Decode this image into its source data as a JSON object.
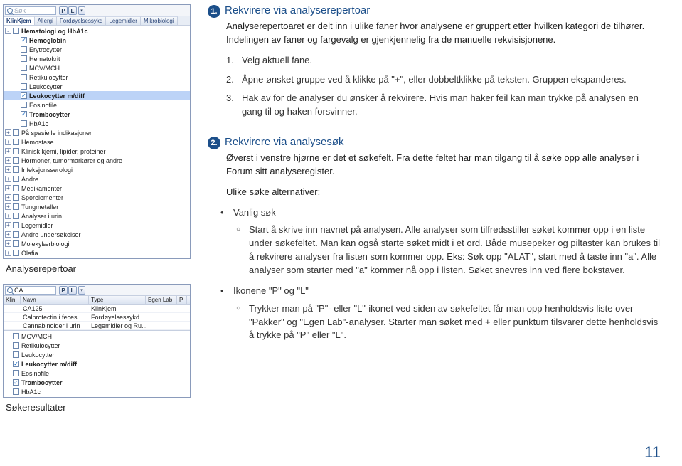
{
  "left_panel_repertoire": {
    "search_placeholder": "Søk",
    "pl_p": "P",
    "pl_l": "L",
    "tabs": [
      "KlinKjem",
      "Allergi",
      "Fordøyelsessykd",
      "Legemidler",
      "Mikrobiologi"
    ],
    "tree": [
      {
        "depth": 0,
        "exp": "-",
        "chk": false,
        "label": "Hematologi og HbA1c",
        "group": true
      },
      {
        "depth": 1,
        "exp": null,
        "chk": true,
        "label": "Hemoglobin",
        "sel": false,
        "bold": true
      },
      {
        "depth": 1,
        "exp": null,
        "chk": false,
        "label": "Erytrocytter"
      },
      {
        "depth": 1,
        "exp": null,
        "chk": false,
        "label": "Hematokrit"
      },
      {
        "depth": 1,
        "exp": null,
        "chk": false,
        "label": "MCV/MCH"
      },
      {
        "depth": 1,
        "exp": null,
        "chk": false,
        "label": "Retikulocytter"
      },
      {
        "depth": 1,
        "exp": null,
        "chk": false,
        "label": "Leukocytter"
      },
      {
        "depth": 1,
        "exp": null,
        "chk": true,
        "label": "Leukocytter m/diff",
        "sel": true,
        "bold": true
      },
      {
        "depth": 1,
        "exp": null,
        "chk": false,
        "label": "Eosinofile"
      },
      {
        "depth": 1,
        "exp": null,
        "chk": true,
        "label": "Trombocytter",
        "bold": true
      },
      {
        "depth": 1,
        "exp": null,
        "chk": false,
        "label": "HbA1c"
      },
      {
        "depth": 0,
        "exp": "+",
        "chk": false,
        "label": "På spesielle indikasjoner"
      },
      {
        "depth": 0,
        "exp": "+",
        "chk": false,
        "label": "Hemostase"
      },
      {
        "depth": 0,
        "exp": "+",
        "chk": false,
        "label": "Klinisk kjemi, lipider, proteiner"
      },
      {
        "depth": 0,
        "exp": "+",
        "chk": false,
        "label": "Hormoner, tumormarkører og andre"
      },
      {
        "depth": 0,
        "exp": "+",
        "chk": false,
        "label": "Infeksjonsserologi"
      },
      {
        "depth": 0,
        "exp": "+",
        "chk": false,
        "label": "Andre"
      },
      {
        "depth": 0,
        "exp": "+",
        "chk": false,
        "label": "Medikamenter"
      },
      {
        "depth": 0,
        "exp": "+",
        "chk": false,
        "label": "Sporelementer"
      },
      {
        "depth": 0,
        "exp": "+",
        "chk": false,
        "label": "Tungmetaller"
      },
      {
        "depth": 0,
        "exp": "+",
        "chk": false,
        "label": "Analyser i urin"
      },
      {
        "depth": 0,
        "exp": "+",
        "chk": false,
        "label": "Legemidler"
      },
      {
        "depth": 0,
        "exp": "+",
        "chk": false,
        "label": "Andre undersøkelser"
      },
      {
        "depth": 0,
        "exp": "+",
        "chk": false,
        "label": "Molekylærbiologi"
      },
      {
        "depth": 0,
        "exp": "+",
        "chk": false,
        "label": "Olafia"
      }
    ]
  },
  "caption_repertoire": "Analyserepertoar",
  "left_panel_search": {
    "search_value": "CA",
    "pl_p": "P",
    "pl_l": "L",
    "columns": [
      "Klin",
      "Navn",
      "Type",
      "Egen Lab",
      "P"
    ],
    "rows": [
      {
        "navn": "CA125",
        "type": "KlinKjem"
      },
      {
        "navn": "Calprotectin i feces",
        "type": "Fordøyelsessykd..."
      },
      {
        "navn": "Cannabinoider i urin",
        "type": "Legemidler og Ru..."
      }
    ],
    "tree": [
      {
        "chk": false,
        "label": "MCV/MCH"
      },
      {
        "chk": false,
        "label": "Retikulocytter"
      },
      {
        "chk": false,
        "label": "Leukocytter"
      },
      {
        "chk": true,
        "label": "Leukocytter m/diff",
        "bold": true
      },
      {
        "chk": false,
        "label": "Eosinofile"
      },
      {
        "chk": true,
        "label": "Trombocytter",
        "bold": true
      },
      {
        "chk": false,
        "label": "HbA1c"
      }
    ]
  },
  "caption_search": "Søkeresultater",
  "section1": {
    "badge": "1.",
    "title": "Rekvirere via analyserepertoar",
    "intro": "Analyserepertoaret er delt inn i ulike faner hvor analysene er gruppert etter hvilken kategori de tilhører. Indelingen av faner og fargevalg er gjenkjennelig fra de manuelle rekvisisjonene.",
    "step1": "Velg aktuell fane.",
    "step2": "Åpne ønsket gruppe ved å klikke på \"+\", eller dobbeltklikke på teksten. Gruppen ekspanderes.",
    "step3": "Hak av for de analyser du ønsker å rekvirere. Hvis man haker feil kan man trykke på analysen en gang til og haken forsvinner."
  },
  "section2": {
    "badge": "2.",
    "title": "Rekvirere via analysesøk",
    "intro": "Øverst i venstre hjørne er det et søkefelt. Fra dette feltet har man tilgang til å søke opp alle analyser i Forum sitt analyseregister.",
    "alt_intro": "Ulike søke alternativer:",
    "b1_label": "Vanlig søk",
    "b1_sub": "Start å skrive inn navnet på analysen. Alle analyser som tilfredsstiller søket kommer opp i en liste under søkefeltet. Man kan også starte søket midt i et ord. Både musepeker og piltaster kan brukes til å rekvirere analyser fra listen som kommer opp. Eks: Søk opp \"ALAT\", start med å taste inn \"a\". Alle analyser som starter med \"a\" kommer nå opp i listen. Søket snevres inn ved flere bokstaver.",
    "b2_label": "Ikonene \"P\" og \"L\"",
    "b2_sub": "Trykker man på \"P\"- eller \"L\"-ikonet ved siden av søkefeltet får man opp henholdsvis liste over \"Pakker\" og \"Egen Lab\"-analyser. Starter man søket med + eller punktum tilsvarer dette henholdsvis å trykke på \"P\" eller \"L\"."
  },
  "page_number": "11"
}
